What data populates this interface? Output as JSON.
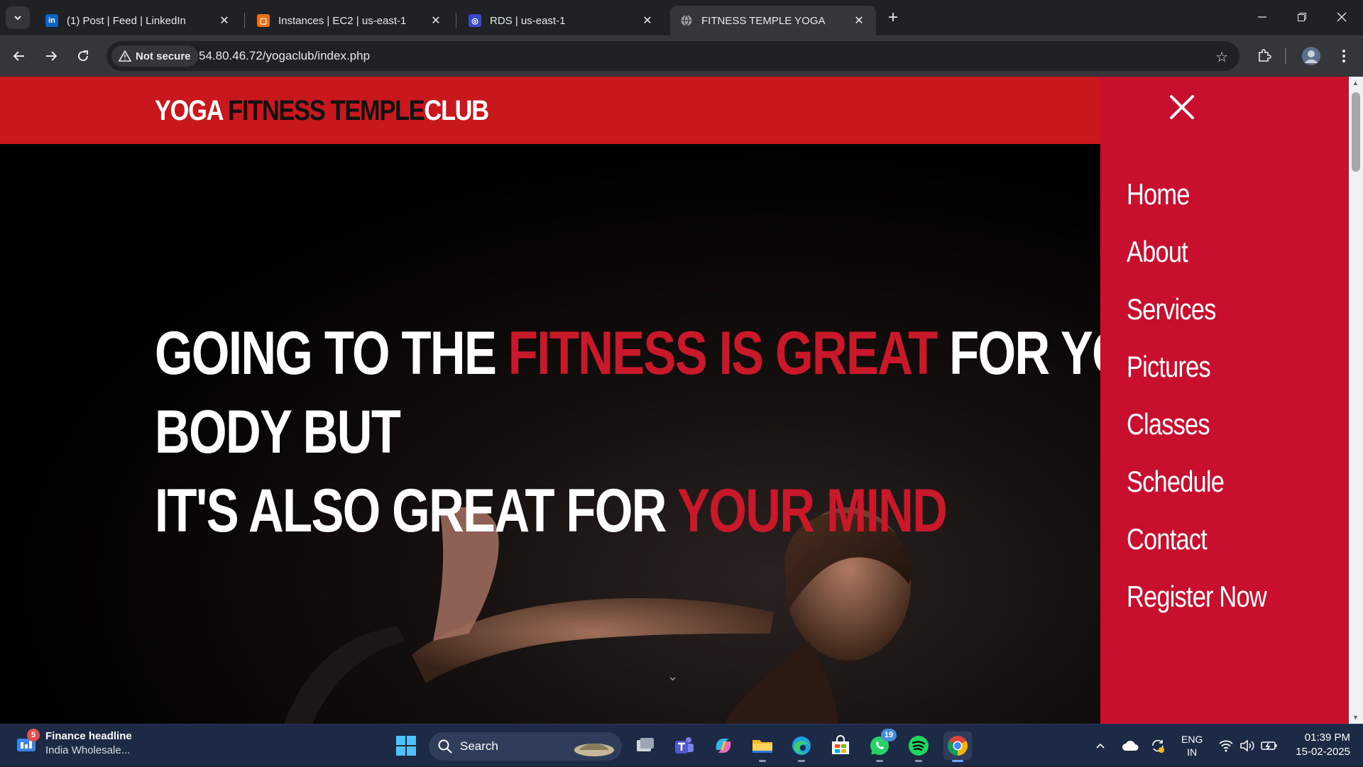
{
  "browser": {
    "tabs": [
      {
        "label": "(1) Post | Feed | LinkedIn",
        "icon": "linkedin-icon",
        "color": "#0a66c2",
        "active": false
      },
      {
        "label": "Instances | EC2 | us-east-1",
        "icon": "aws-ec2-icon",
        "color": "#e8711a",
        "active": false
      },
      {
        "label": "RDS | us-east-1",
        "icon": "aws-rds-icon",
        "color": "#3b48cc",
        "active": false
      },
      {
        "label": "FITNESS TEMPLE YOGA",
        "icon": "globe-icon",
        "color": "#9aa0a6",
        "active": true
      }
    ],
    "security_label": "Not secure",
    "url": "54.80.46.72/yogaclub/index.php"
  },
  "site": {
    "logo": {
      "part1": "YOGA ",
      "part2": "FITNESS TEMPLE",
      "part3": "CLUB"
    },
    "headline": {
      "l1_a": "GOING TO THE ",
      "l1_b": "FITNESS IS GREAT",
      "l1_c": " FOR YOUR",
      "l2": "BODY BUT",
      "l3_a": "IT'S ALSO GREAT FOR ",
      "l3_b": "YOUR MIND"
    },
    "menu": [
      "Home",
      "About",
      "Services",
      "Pictures",
      "Classes",
      "Schedule",
      "Contact",
      "Register Now"
    ],
    "colors": {
      "header_red": "#c8181d",
      "menu_red": "#c8102e",
      "accent_red": "#c8182a"
    }
  },
  "taskbar": {
    "news_title": "Finance headline",
    "news_sub": "India Wholesale...",
    "news_badge": "5",
    "search_label": "Search",
    "whatsapp_badge": "19",
    "lang_1": "ENG",
    "lang_2": "IN",
    "time": "01:39 PM",
    "date": "15-02-2025"
  }
}
